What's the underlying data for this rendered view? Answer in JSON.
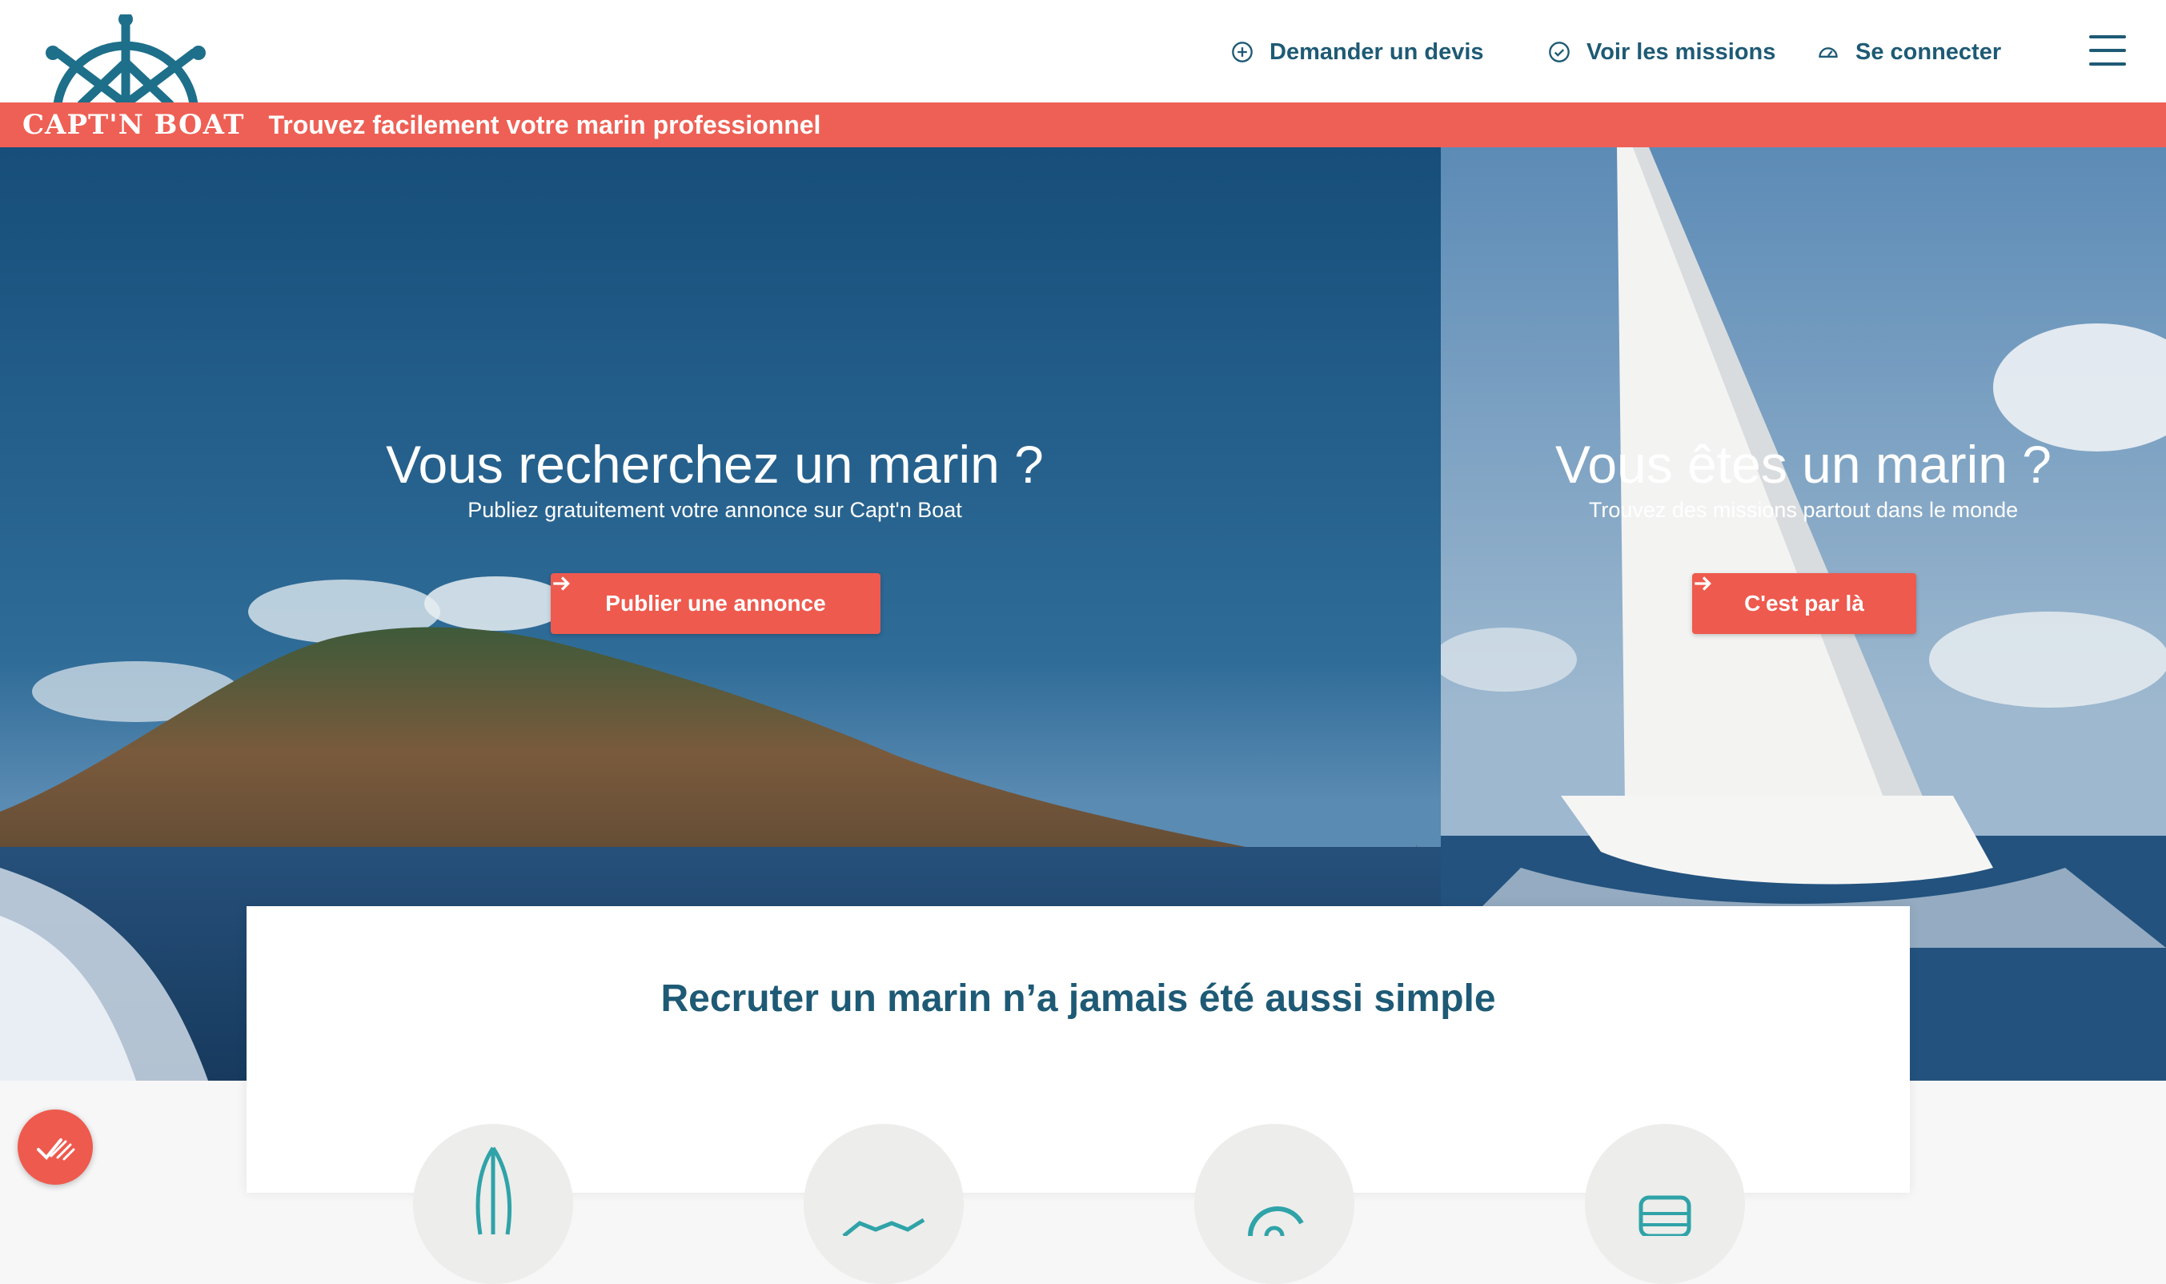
{
  "header": {
    "brand": "CAPT'N BOAT",
    "tagline": "Trouvez facilement votre marin professionnel",
    "nav": {
      "quote_label": "Demander un devis",
      "missions_label": "Voir les missions",
      "login_label": "Se connecter"
    }
  },
  "hero": {
    "left": {
      "title": "Vous recherchez un marin ?",
      "subtitle": "Publiez gratuitement votre annonce sur Capt'n Boat",
      "cta_label": "Publier une annonce"
    },
    "right": {
      "title": "Vous êtes un marin ?",
      "subtitle": "Trouvez des missions partout dans le monde",
      "cta_label": "C'est par là"
    }
  },
  "features": {
    "title": "Recruter un marin n’a jamais été aussi simple"
  },
  "colors": {
    "brand_dark": "#1e5a75",
    "accent": "#ee5a4e",
    "banner": "#ee6055"
  },
  "icons": [
    "ship-wheel-icon",
    "plus-circle-icon",
    "check-circle-icon",
    "dashboard-icon",
    "menu-icon",
    "arrow-right-icon",
    "sailboat-icon",
    "handshake-icon",
    "refresh-icon",
    "boat-icon",
    "checkmarks-icon"
  ]
}
